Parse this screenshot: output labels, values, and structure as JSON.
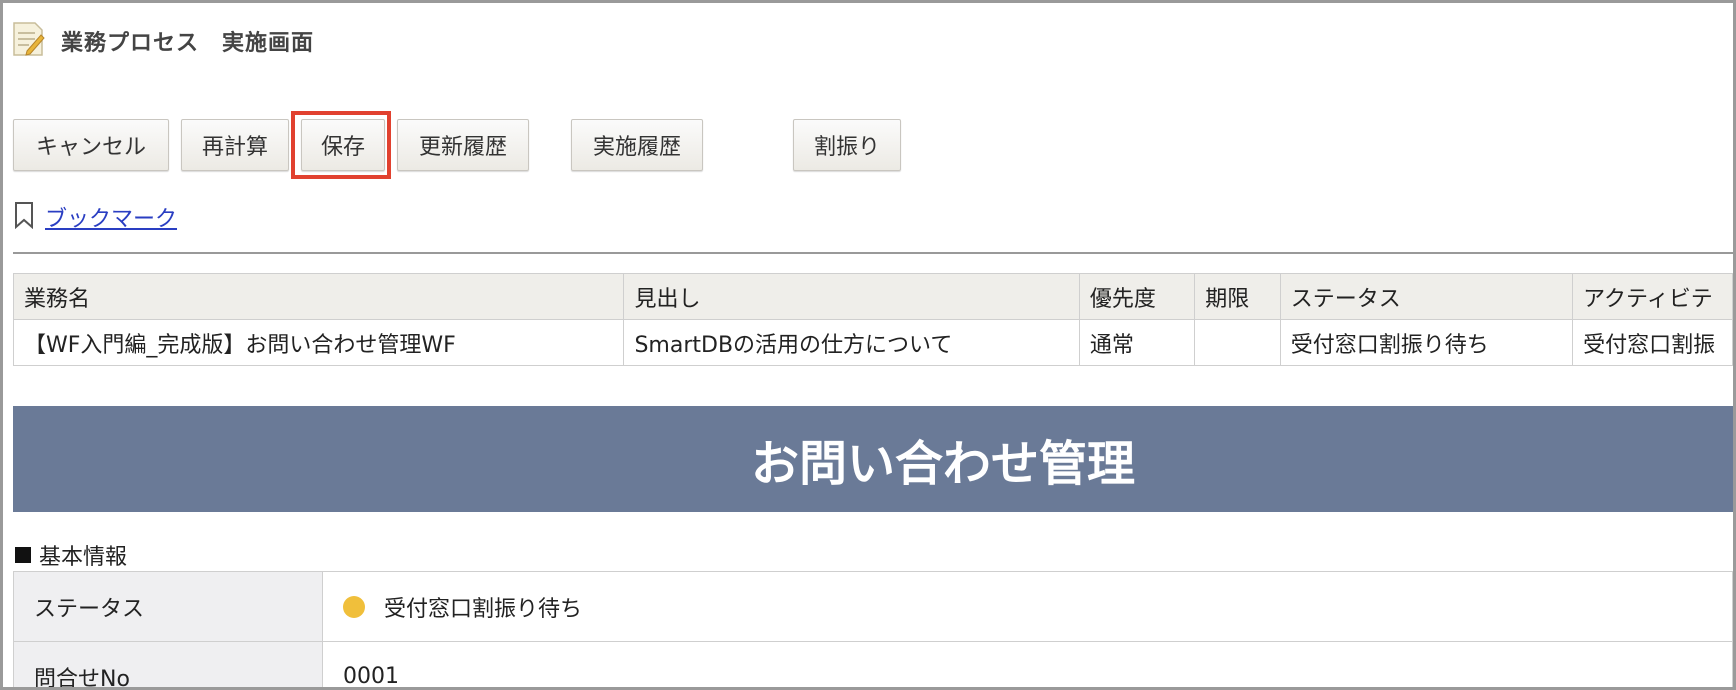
{
  "header": {
    "title": "業務プロセス　実施画面",
    "icon": "memo-icon"
  },
  "toolbar": {
    "cancel": "キャンセル",
    "recalc": "再計算",
    "save": "保存",
    "update_history": "更新履歴",
    "exec_history": "実施履歴",
    "assign": "割振り"
  },
  "bookmark": {
    "label": "ブックマーク",
    "icon": "bookmark-icon"
  },
  "info_table": {
    "headers": [
      "業務名",
      "見出し",
      "優先度",
      "期限",
      "ステータス",
      "アクティビテ"
    ],
    "row": [
      "【WF入門編_完成版】お問い合わせ管理WF",
      "SmartDBの活用の仕方について",
      "通常",
      "",
      "受付窓口割振り待ち",
      "受付窓口割振"
    ]
  },
  "banner": {
    "title": "お問い合わせ管理"
  },
  "section": {
    "title": "基本情報"
  },
  "basic_info": {
    "status_label": "ステータス",
    "status_value": "受付窓口割振り待ち",
    "inquiry_no_label": "問合せNo",
    "inquiry_no_value": "0001"
  },
  "colors": {
    "banner": "#6a7a97",
    "highlight": "#e1412f",
    "status_dot": "#f0bf3b",
    "link": "#2a3ec2"
  }
}
